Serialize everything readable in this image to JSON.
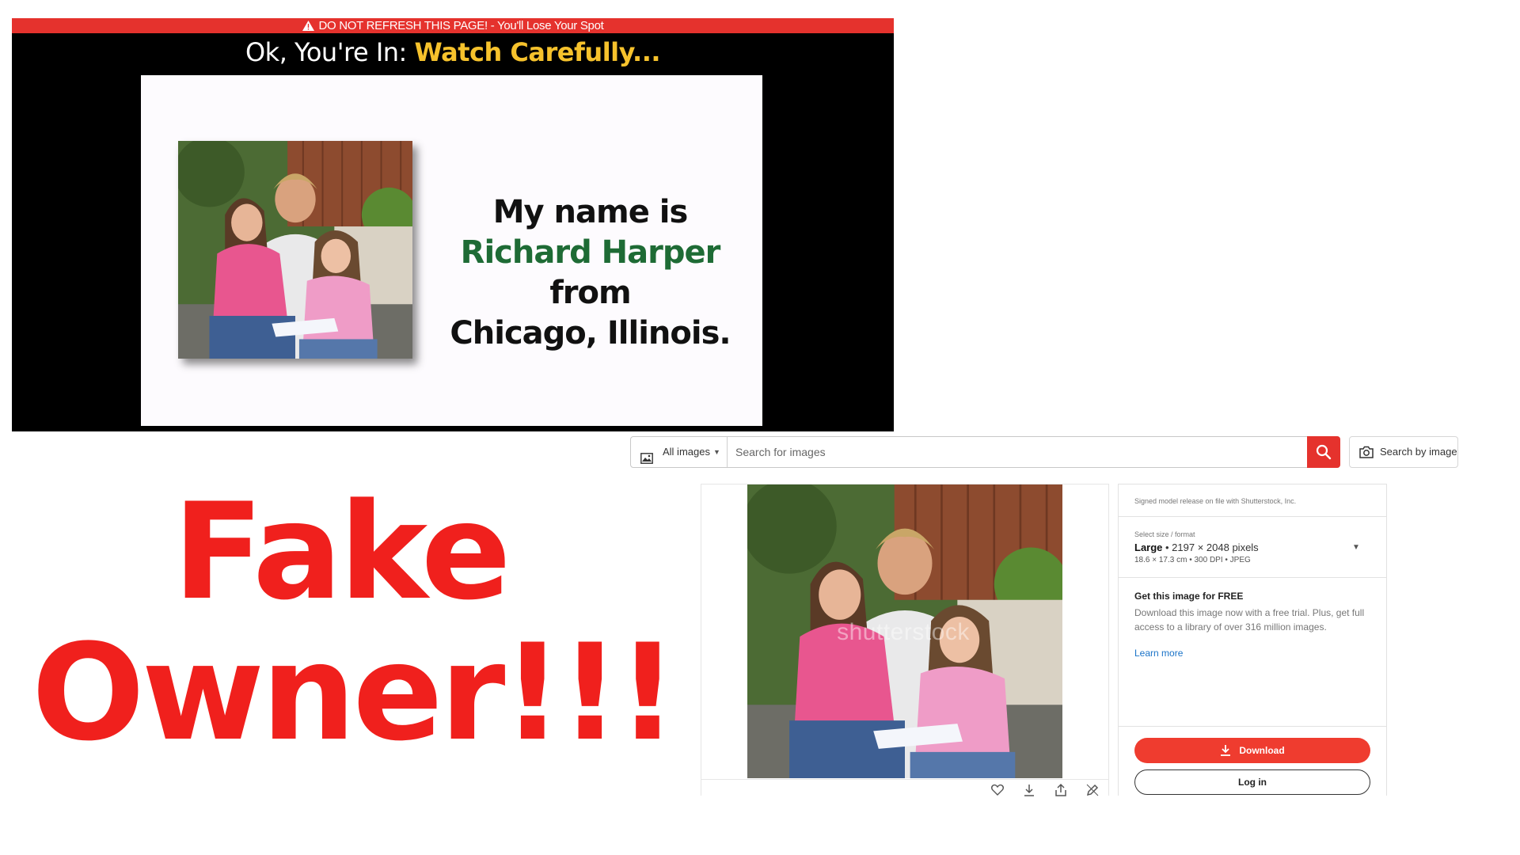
{
  "warning_bar": {
    "text": "DO NOT REFRESH THIS PAGE! - You'll Lose Your Spot"
  },
  "headline": {
    "prefix": "Ok, You're In: ",
    "accent": "Watch Carefully..."
  },
  "slide": {
    "line1": "My name is",
    "name": "Richard Harper",
    "from": " from",
    "line3": "Chicago, Illinois."
  },
  "callout": {
    "line1": "Fake",
    "line2": "Owner!!!"
  },
  "search": {
    "filter_label": "All images",
    "placeholder": "Search for images",
    "search_by_image_label": "Search by image"
  },
  "preview": {
    "watermark": "shutterstock"
  },
  "details": {
    "release_note": "Signed model release on file with Shutterstock, Inc.",
    "size_label": "Select size / format",
    "size_name": "Large",
    "size_pixels": " • 2197 × 2048 pixels",
    "size_sub": "18.6 × 17.3 cm • 300 DPI • JPEG",
    "free_title": "Get this image for FREE",
    "free_desc": "Download this image now with a free trial. Plus, get full access to a library of over 316 million images.",
    "learn_more": "Learn more",
    "download_label": "Download",
    "login_label": "Log in"
  },
  "colors": {
    "warning_red": "#e5322d",
    "headline_accent": "#f6c22c",
    "name_green": "#1e6b35",
    "callout_red": "#f0201d",
    "primary_red": "#ef3c2f",
    "link_blue": "#1a73c8"
  },
  "icons": {
    "warning": "warning-triangle-icon",
    "filter": "image-icon",
    "search": "search-icon",
    "search_by_image": "camera-icon",
    "like": "heart-icon",
    "download": "download-icon",
    "share": "share-icon",
    "edit": "edit-icon"
  }
}
